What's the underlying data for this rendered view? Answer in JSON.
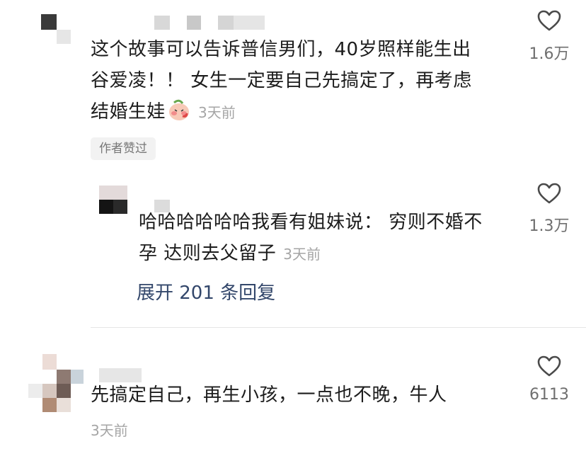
{
  "comments": [
    {
      "text_line1": "这个故事可以告诉普信男们，40岁照样能生出",
      "text_line2": "谷爱凌！！ 女生一定要自己先搞定了，再考虑",
      "text_line3": "结婚生娃",
      "time": "3天前",
      "likes": "1.6万",
      "badge": "作者赞过",
      "emoji_icon": "blushing-face-emoji",
      "replies": [
        {
          "text_line1": "哈哈哈哈哈哈我看有姐妹说：  穷则不婚不",
          "text_line2": "孕 达则去父留子",
          "time": "3天前",
          "likes": "1.3万"
        }
      ],
      "expand_label": "展开 201 条回复"
    },
    {
      "text_line1": "先搞定自己，再生小孩，一点也不晚，牛人",
      "time": "3天前",
      "likes": "6113"
    }
  ]
}
